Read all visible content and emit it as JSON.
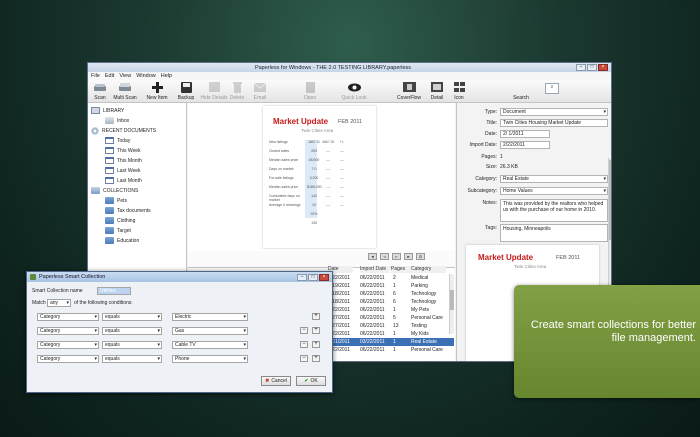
{
  "window": {
    "title": "Paperless for Windows - THE 2.0 TESTING LIBRARY.paperless"
  },
  "menu": [
    "File",
    "Edit",
    "View",
    "Window",
    "Help"
  ],
  "toolbar": {
    "buttons": [
      {
        "label": "Scan",
        "icon": "scanner-icon"
      },
      {
        "label": "Multi Scan",
        "icon": "multi-scanner-icon"
      },
      {
        "label": "New Item",
        "icon": "plus-icon"
      },
      {
        "label": "Backup",
        "icon": "backup-icon"
      },
      {
        "label": "Hide Details",
        "icon": "hide-details-icon"
      },
      {
        "label": "Delete",
        "icon": "delete-icon"
      },
      {
        "label": "Email",
        "icon": "email-icon"
      },
      {
        "label": "Open",
        "icon": "open-icon"
      },
      {
        "label": "Quick Look",
        "icon": "eye-icon"
      },
      {
        "label": "CoverFlow",
        "icon": "coverflow-icon"
      },
      {
        "label": "Detail",
        "icon": "detail-view-icon"
      },
      {
        "label": "Icon",
        "icon": "icon-view-icon"
      },
      {
        "label": "Search",
        "icon": "search-icon"
      }
    ]
  },
  "sidebar": {
    "library_header": "LIBRARY",
    "inbox": "Inbox",
    "recent_header": "RECENT DOCUMENTS",
    "recent": [
      "Today",
      "This Week",
      "This Month",
      "Last Week",
      "Last Month"
    ],
    "collections_header": "COLLECTIONS",
    "collections": [
      "Pets",
      "Tax documents",
      "Clothing",
      "Target",
      "Education"
    ]
  },
  "preview": {
    "title": "Market Update",
    "date": "FEB 2011",
    "subtitle": "Twin Cities Area",
    "rows": [
      {
        "label": "New listings",
        "a": "JAN '11",
        "b": "JAN '10",
        "c": "+/-"
      },
      {
        "label": "Closed sales",
        "a": "253",
        "b": "—",
        "c": "—"
      },
      {
        "label": "Median sales price",
        "a": "48,500",
        "b": "—",
        "c": "—"
      },
      {
        "label": "Days on market",
        "a": "7.0",
        "b": "—",
        "c": "—"
      },
      {
        "label": "For-sale listings",
        "a": "3,200",
        "b": "—",
        "c": "—"
      },
      {
        "label": "Median sales price",
        "a": "$186,000",
        "b": "—",
        "c": "—"
      },
      {
        "label": "Cumulative days on market",
        "a": "142",
        "b": "—",
        "c": "—"
      },
      {
        "label": "Average # showings",
        "a": "10",
        "b": "—",
        "c": "—"
      },
      {
        "label": "",
        "a": "92%",
        "b": "",
        "c": ""
      },
      {
        "label": "",
        "a": "130",
        "b": "",
        "c": ""
      }
    ]
  },
  "list": {
    "columns": [
      "Date",
      "Import Date",
      "Pages",
      "Category"
    ],
    "rows": [
      {
        "date": "2/22/2011",
        "import": "06/22/2011",
        "pages": "2",
        "category": "Medical",
        "selected": false
      },
      {
        "date": "2/19/2011",
        "import": "06/22/2011",
        "pages": "1",
        "category": "Parking",
        "selected": false
      },
      {
        "date": "2/18/2011",
        "import": "06/22/2011",
        "pages": "6",
        "category": "Technology",
        "selected": false
      },
      {
        "date": "2/18/2011",
        "import": "06/22/2011",
        "pages": "6",
        "category": "Technology",
        "selected": false
      },
      {
        "date": "2/22/2011",
        "import": "06/22/2011",
        "pages": "1",
        "category": "My Pets",
        "selected": false
      },
      {
        "date": "2/27/2011",
        "import": "06/22/2011",
        "pages": "5",
        "category": "Personal Care",
        "selected": false
      },
      {
        "date": "2/27/2011",
        "import": "06/22/2011",
        "pages": "13",
        "category": "Testing",
        "selected": false
      },
      {
        "date": "2/22/2011",
        "import": "06/22/2011",
        "pages": "1",
        "category": "My Kids",
        "selected": false
      },
      {
        "date": "2/01/2011",
        "import": "03/22/2011",
        "pages": "1",
        "category": "Real Estate",
        "selected": true
      },
      {
        "date": "2/22/2011",
        "import": "06/22/2011",
        "pages": "1",
        "category": "Personal Care",
        "selected": false
      }
    ]
  },
  "details": {
    "type_label": "Type:",
    "type_value": "Document",
    "title_label": "Title:",
    "title_value": "Twin Cities Housing Market Update",
    "date_label": "Date:",
    "date_value": "2/ 1/2011",
    "import_label": "Import Date:",
    "import_value": "2/22/2011",
    "pages_label": "Pages:",
    "pages_value": "1",
    "size_label": "Size:",
    "size_value": "26.3 KB",
    "category_label": "Category:",
    "category_value": "Real Estate",
    "subcategory_label": "Subcategory:",
    "subcategory_value": "Home Values",
    "notes_label": "Notes:",
    "notes_value": "This was provided by the realtors who helped us with the purchase of our home in 2010.",
    "tags_label": "Tags:",
    "tags_value": "Housing, Minneapolis",
    "thumb_title": "Market Update",
    "thumb_date": "FEB 2011",
    "thumb_subtitle": "Twin Cities Area"
  },
  "dialog": {
    "title": "Paperless Smart Collection",
    "name_label": "Smart Collection name",
    "name_value": "Utilities",
    "match_label": "Match",
    "match_value": "any",
    "match_suffix": "of the following conditions:",
    "conditions": [
      {
        "field": "Category",
        "op": "equals",
        "value": "Electric"
      },
      {
        "field": "Category",
        "op": "equals",
        "value": "Gas"
      },
      {
        "field": "Category",
        "op": "equals",
        "value": "Cable TV"
      },
      {
        "field": "Category",
        "op": "equals",
        "value": "Phone"
      }
    ],
    "minus": "−",
    "plus": "+",
    "cancel_label": "Cancel",
    "ok_label": "OK"
  },
  "callout": {
    "text": "Create smart collections for better file management."
  },
  "colors": {
    "callout": "#6e8e36",
    "selection": "#3b6fb6",
    "brand_red": "#c41a1a"
  }
}
